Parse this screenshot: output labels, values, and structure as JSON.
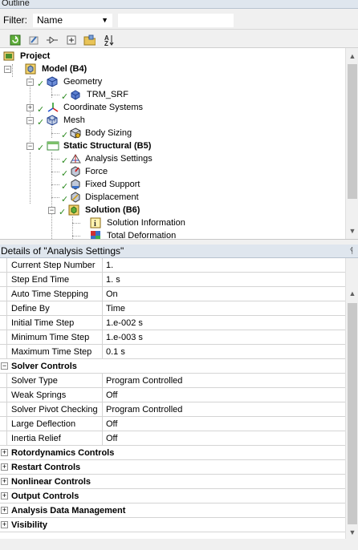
{
  "outline": {
    "title": "Outline",
    "filter_label": "Filter:",
    "filter_value": "Name",
    "filter_text": ""
  },
  "toolbar": {
    "icons": [
      "refresh-icon",
      "edit-icon",
      "expand-environment-icon",
      "expand-all-icon",
      "folder-icon",
      "sort-icon"
    ]
  },
  "tree": [
    {
      "label": "Project",
      "bold": true
    },
    {
      "label": "Model (B4)",
      "bold": true
    },
    {
      "label": "Geometry",
      "bold": false
    },
    {
      "label": "TRM_SRF",
      "bold": false
    },
    {
      "label": "Coordinate Systems",
      "bold": false
    },
    {
      "label": "Mesh",
      "bold": false
    },
    {
      "label": "Body Sizing",
      "bold": false
    },
    {
      "label": "Static Structural (B5)",
      "bold": true
    },
    {
      "label": "Analysis Settings",
      "bold": false
    },
    {
      "label": "Force",
      "bold": false
    },
    {
      "label": "Fixed Support",
      "bold": false
    },
    {
      "label": "Displacement",
      "bold": false
    },
    {
      "label": "Solution (B6)",
      "bold": true
    },
    {
      "label": "Solution Information",
      "bold": false
    },
    {
      "label": "Total Deformation",
      "bold": false
    }
  ],
  "details": {
    "title": "Details of \"Analysis Settings\"",
    "rows": [
      {
        "name": "Current Step Number",
        "value": "1."
      },
      {
        "name": "Step End Time",
        "value": "1. s"
      },
      {
        "name": "Auto Time Stepping",
        "value": "On"
      },
      {
        "name": "Define By",
        "value": "Time"
      },
      {
        "name": "Initial Time Step",
        "value": "1.e-002 s"
      },
      {
        "name": "Minimum Time Step",
        "value": "1.e-003 s"
      },
      {
        "name": "Maximum Time Step",
        "value": "0.1 s"
      }
    ],
    "solver_group": "Solver Controls",
    "solver_rows": [
      {
        "name": "Solver Type",
        "value": "Program Controlled"
      },
      {
        "name": "Weak Springs",
        "value": "Off"
      },
      {
        "name": "Solver Pivot Checking",
        "value": "Program Controlled"
      },
      {
        "name": "Large Deflection",
        "value": "Off"
      },
      {
        "name": "Inertia Relief",
        "value": "Off"
      }
    ],
    "collapsed_groups": [
      "Rotordynamics Controls",
      "Restart Controls",
      "Nonlinear Controls",
      "Output Controls",
      "Analysis Data Management",
      "Visibility"
    ]
  },
  "colors": {
    "check": "#2b8a1f",
    "header": "#dfe6ee"
  }
}
